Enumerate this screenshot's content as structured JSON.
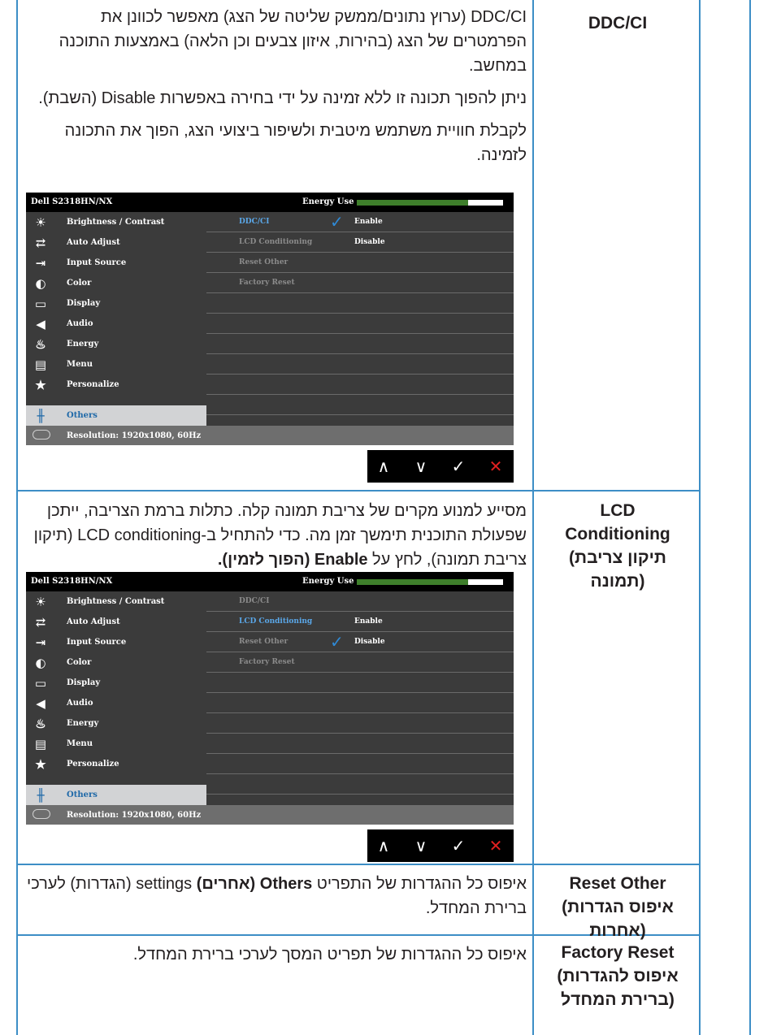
{
  "rows": [
    {
      "term": "DDC/CI",
      "paragraphs": [
        "DDC/CI (ערוץ נתונים/ממשק שליטה של הצג) מאפשר לכוונן את הפרמטרים של הצג (בהירות, איזון צבעים וכן הלאה) באמצעות התוכנה במחשב.",
        "ניתן להפוך תכונה זו ללא זמינה על ידי בחירה באפשרות Disable (השבת).",
        "לקבלת חוויית משתמש מיטבית ולשיפור ביצועי הצג, הפוך את התכונה לזמינה."
      ]
    },
    {
      "term_lines": [
        "LCD",
        "Conditioning",
        "(תיקון צריבת",
        "תמונה)"
      ],
      "text_before": "מסייע למנוע מקרים של צריבת תמונה קלה. כתלות ברמת הצריבה, ייתכן שפעולת התוכנית תימשך זמן מה. כדי להתחיל ב-LCD conditioning (תיקון צריבת תמונה), לחץ על ",
      "text_bold": "Enable (הפוך לזמין).",
      "text_after": ""
    },
    {
      "term_lines": [
        "Reset Other",
        "(איפוס הגדרות",
        "אחרות)"
      ],
      "text_before": "איפוס כל ההגדרות של התפריט ",
      "text_bold": "Others (אחרים)",
      "text_after": " settings (הגדרות) לערכי ברירת המחדל."
    },
    {
      "term_lines": [
        "Factory Reset",
        "(איפוס להגדרות",
        "ברירת המחדל)"
      ],
      "text": "איפוס כל ההגדרות של תפריט המסך לערכי ברירת המחדל."
    }
  ],
  "osd": {
    "model": "Dell S2318HN/NX",
    "energy_label": "Energy Use",
    "menu": [
      {
        "label": "Brightness / Contrast",
        "icon": "sun-icon"
      },
      {
        "label": "Auto Adjust",
        "icon": "auto-adjust-icon"
      },
      {
        "label": "Input Source",
        "icon": "input-source-icon"
      },
      {
        "label": "Color",
        "icon": "color-palette-icon"
      },
      {
        "label": "Display",
        "icon": "display-monitor-icon"
      },
      {
        "label": "Audio",
        "icon": "speaker-icon"
      },
      {
        "label": "Energy",
        "icon": "energy-flame-icon"
      },
      {
        "label": "Menu",
        "icon": "menu-window-icon"
      },
      {
        "label": "Personalize",
        "icon": "star-icon"
      },
      {
        "label": "Others",
        "icon": "others-sliders-icon"
      }
    ],
    "options": [
      "DDC/CI",
      "LCD Conditioning",
      "Reset Other",
      "Factory Reset"
    ],
    "enable_label": "Enable",
    "disable_label": "Disable",
    "resolution": "Resolution: 1920x1080, 60Hz",
    "energy_level": 0.76
  },
  "nav_buttons": {
    "up": "∧",
    "down": "∨",
    "ok": "✓",
    "close": "✕"
  },
  "colors": {
    "border": "#3d8ec6",
    "osd_selected_text": "#1f69a8",
    "check": "#2f8ad6",
    "close": "#e02020",
    "energy_bar": "#3e7f2b"
  }
}
